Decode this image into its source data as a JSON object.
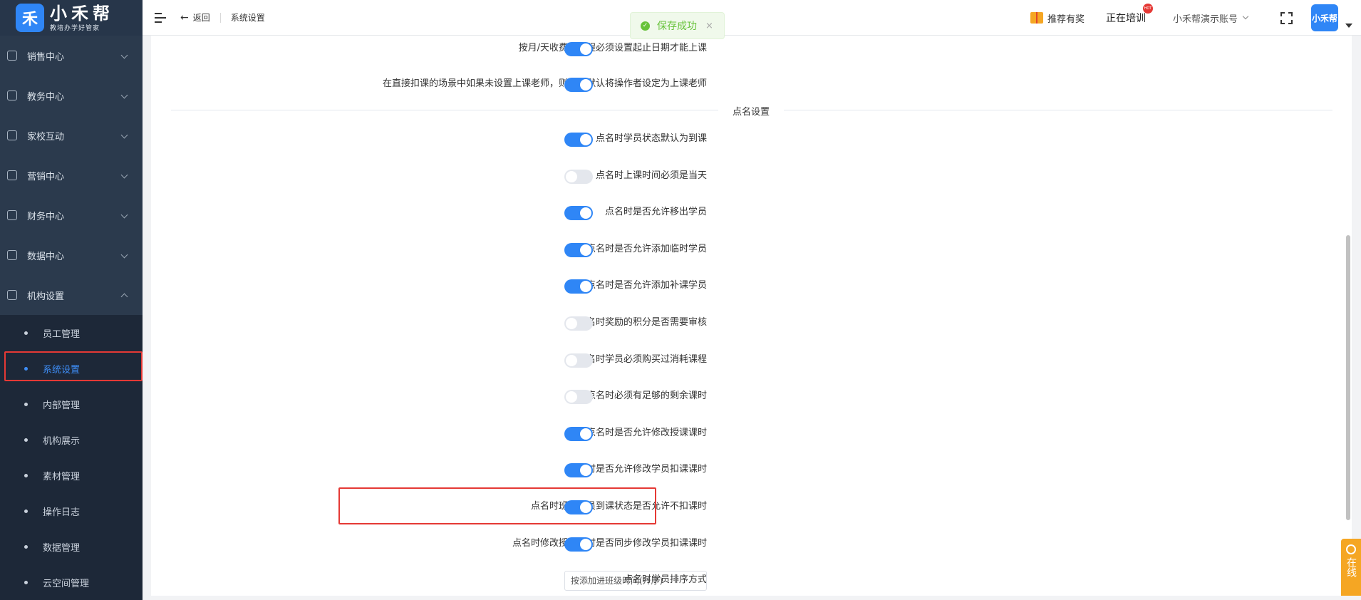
{
  "logo": {
    "title": "小禾帮",
    "subtitle": "教培办学好管家",
    "mark": "禾"
  },
  "sidebar": {
    "menus": [
      {
        "label": "销售中心",
        "icon": "user-icon"
      },
      {
        "label": "教务中心",
        "icon": "book-icon"
      },
      {
        "label": "家校互动",
        "icon": "send-icon"
      },
      {
        "label": "营销中心",
        "icon": "share-icon"
      },
      {
        "label": "财务中心",
        "icon": "wallet-icon"
      },
      {
        "label": "数据中心",
        "icon": "chart-icon"
      },
      {
        "label": "机构设置",
        "icon": "gear-icon"
      }
    ],
    "submenu": [
      {
        "label": "员工管理"
      },
      {
        "label": "系统设置"
      },
      {
        "label": "内部管理"
      },
      {
        "label": "机构展示"
      },
      {
        "label": "素材管理"
      },
      {
        "label": "操作日志"
      },
      {
        "label": "数据管理"
      },
      {
        "label": "云空间管理"
      }
    ]
  },
  "header": {
    "back_label": "返回",
    "breadcrumb": "系统设置",
    "reward_label": "推荐有奖",
    "training_label": "正在培训",
    "hot_badge": "HOT",
    "account_label": "小禾帮演示账号",
    "avatar_text": "小禾帮"
  },
  "toast": {
    "message": "保存成功",
    "close": "×"
  },
  "settings": {
    "top": [
      {
        "label": "按月/天收费的课程必须设置起止日期才能上课",
        "on": true
      },
      {
        "label": "在直接扣课的场景中如果未设置上课老师，则系统默认将操作者设定为上课老师",
        "on": true
      }
    ],
    "section_title": "点名设置",
    "rollcall": [
      {
        "label": "点名时学员状态默认为到课",
        "on": true
      },
      {
        "label": "点名时上课时间必须是当天",
        "on": false
      },
      {
        "label": "点名时是否允许移出学员",
        "on": true
      },
      {
        "label": "点名时是否允许添加临时学员",
        "on": true
      },
      {
        "label": "点名时是否允许添加补课学员",
        "on": true
      },
      {
        "label": "点名时奖励的积分是否需要审核",
        "on": false
      },
      {
        "label": "点名时学员必须购买过消耗课程",
        "on": false
      },
      {
        "label": "点名时必须有足够的剩余课时",
        "on": false
      },
      {
        "label": "点名时是否允许修改授课课时",
        "on": true
      },
      {
        "label": "点名时是否允许修改学员扣课课时",
        "on": true
      },
      {
        "label": "点名时班级学员到课状态是否允许不扣课时",
        "on": true
      },
      {
        "label": "点名时修改授课课时是否同步修改学员扣课课时",
        "on": true
      }
    ],
    "sort_label": "点名时学员排序方式",
    "sort_value": "按添加进班级时间(升序)"
  },
  "online_label": "在线"
}
